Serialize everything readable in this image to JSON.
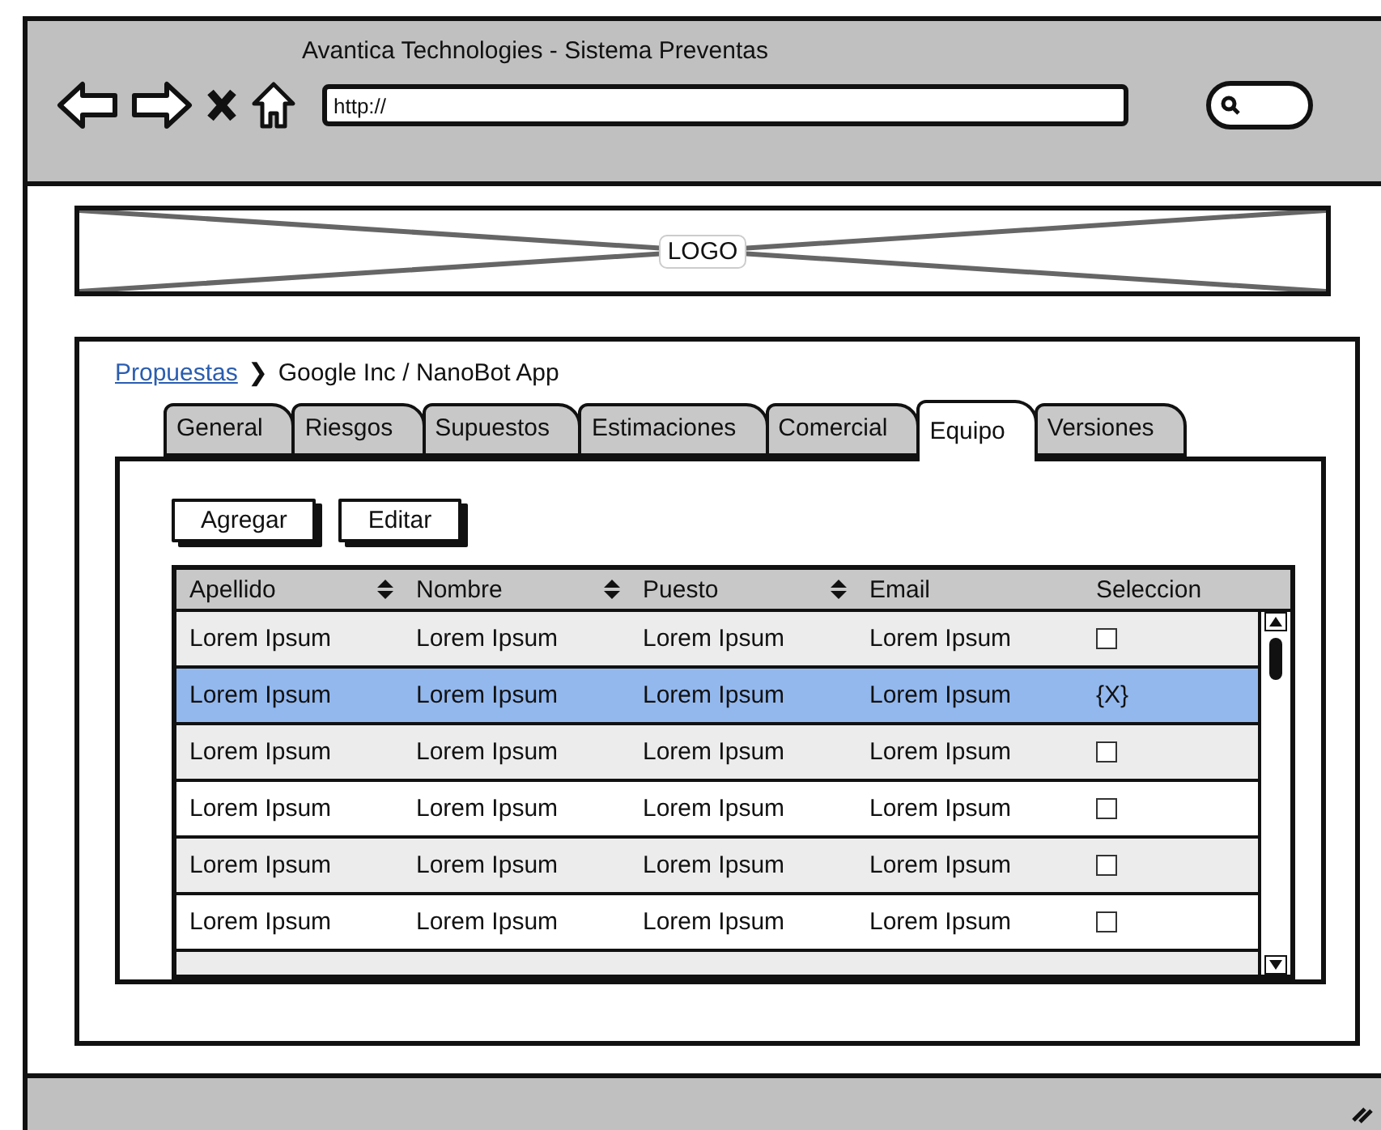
{
  "window": {
    "title": "Avantica Technologies - Sistema Preventas"
  },
  "address_bar": {
    "value": "http://"
  },
  "logo": {
    "label": "LOGO"
  },
  "breadcrumb": {
    "link": "Propuestas",
    "separator": "❯",
    "current": "Google Inc / NanoBot App"
  },
  "tabs": [
    {
      "label": "General",
      "selected": false
    },
    {
      "label": "Riesgos",
      "selected": false
    },
    {
      "label": "Supuestos",
      "selected": false
    },
    {
      "label": "Estimaciones",
      "selected": false
    },
    {
      "label": "Comercial",
      "selected": false
    },
    {
      "label": "Equipo",
      "selected": true
    },
    {
      "label": "Versiones",
      "selected": false
    }
  ],
  "buttons": [
    "Agregar",
    "Editar"
  ],
  "table": {
    "columns": [
      {
        "label": "Apellido",
        "sortable": true
      },
      {
        "label": "Nombre",
        "sortable": true
      },
      {
        "label": "Puesto",
        "sortable": true
      },
      {
        "label": "Email",
        "sortable": false
      },
      {
        "label": "Seleccion",
        "sortable": false
      }
    ],
    "rows": [
      {
        "cells": [
          "Lorem Ipsum",
          "Lorem Ipsum",
          "Lorem Ipsum",
          "Lorem Ipsum"
        ],
        "selected": false,
        "selection": {
          "kind": "checkbox",
          "checked": false
        }
      },
      {
        "cells": [
          "Lorem Ipsum",
          "Lorem Ipsum",
          "Lorem Ipsum",
          "Lorem Ipsum"
        ],
        "selected": true,
        "selection": {
          "kind": "text",
          "text": "{X}"
        }
      },
      {
        "cells": [
          "Lorem Ipsum",
          "Lorem Ipsum",
          "Lorem Ipsum",
          "Lorem Ipsum"
        ],
        "selected": false,
        "selection": {
          "kind": "checkbox",
          "checked": false
        }
      },
      {
        "cells": [
          "Lorem Ipsum",
          "Lorem Ipsum",
          "Lorem Ipsum",
          "Lorem Ipsum"
        ],
        "selected": false,
        "selection": {
          "kind": "checkbox",
          "checked": false
        }
      },
      {
        "cells": [
          "Lorem Ipsum",
          "Lorem Ipsum",
          "Lorem Ipsum",
          "Lorem Ipsum"
        ],
        "selected": false,
        "selection": {
          "kind": "checkbox",
          "checked": false
        }
      },
      {
        "cells": [
          "Lorem Ipsum",
          "Lorem Ipsum",
          "Lorem Ipsum",
          "Lorem Ipsum"
        ],
        "selected": false,
        "selection": {
          "kind": "checkbox",
          "checked": false
        }
      }
    ]
  }
}
